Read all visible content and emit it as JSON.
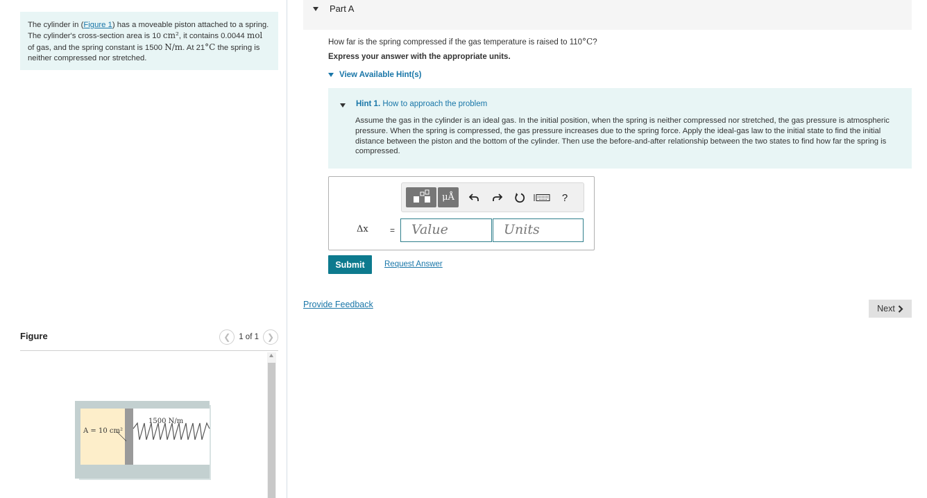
{
  "problem": {
    "intro": "The cylinder in (",
    "figure_link": "Figure 1",
    "after_link": ") has a moveable piston attached to a spring. The cylinder's cross-section area is 10 ",
    "area_unit": "cm²",
    "contains": ", it contains 0.0044 ",
    "mol_unit": "mol",
    "gas_const": " of gas, and the spring constant is 1500 ",
    "spring_unit": "N/m",
    "at_text": ". At 21",
    "temp_unit": "°C",
    "rest": " the spring is neither compressed nor stretched."
  },
  "figure_panel": {
    "title": "Figure",
    "pager_label": "1 of 1",
    "area_label": "A = 10 cm²",
    "spring_label": "1500 N/m"
  },
  "part": {
    "title": "Part A"
  },
  "question": {
    "text_before": "How far is the spring compressed if the gas temperature is raised to 110",
    "temp_unit": "°C",
    "text_after": "?",
    "instructions": "Express your answer with the appropriate units."
  },
  "hints": {
    "toggle_label": "View Available Hint(s)",
    "hint_number": "Hint 1.",
    "hint_title": "How to approach the problem",
    "hint_text": "Assume the gas in the cylinder is an ideal gas. In the initial position, when the spring is neither compressed nor stretched, the gas pressure is atmospheric pressure. When the spring is compressed, the gas pressure increases due to the spring force. Apply the ideal-gas law to the initial state to find the initial distance between the piston and the bottom of the cylinder. Then use the before-and-after relationship between the two states to find how far the spring is compressed."
  },
  "answer": {
    "variable_label": "Δx",
    "equals": "=",
    "value_placeholder": "Value",
    "units_placeholder": "Units",
    "toolbar": {
      "units_button": "μÅ",
      "help": "?"
    }
  },
  "actions": {
    "submit": "Submit",
    "request_answer": "Request Answer",
    "feedback": "Provide Feedback",
    "next": "Next"
  }
}
